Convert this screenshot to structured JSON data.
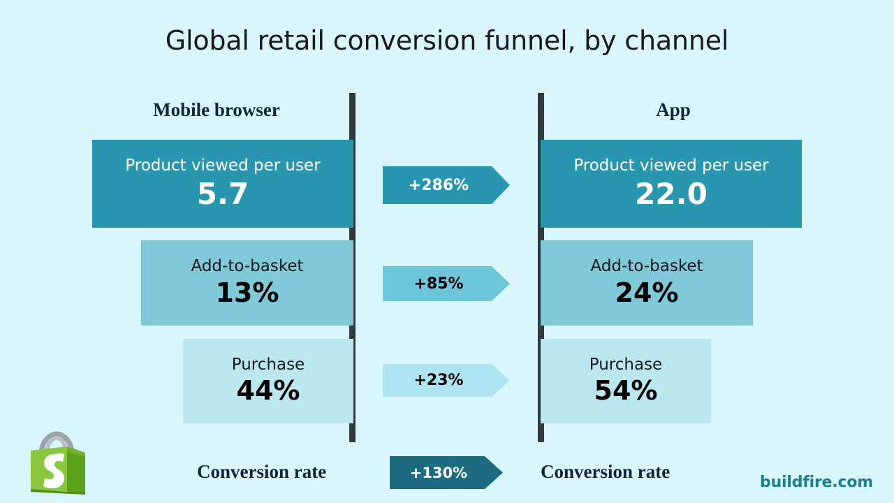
{
  "title": "Global retail conversion funnel, by channel",
  "background_color": "#d9f6fc",
  "columns": {
    "left": {
      "heading": "Mobile browser",
      "conversion_label": "Conversion rate"
    },
    "right": {
      "heading": "App",
      "conversion_label": "Conversion rate"
    }
  },
  "stages": [
    {
      "label": "Product viewed per user",
      "left_value": "5.7",
      "right_value": "22.0",
      "delta": "+286%",
      "bar_color": "#2896af",
      "badge_color": "#2896af"
    },
    {
      "label": "Add-to-basket",
      "left_value": "13%",
      "right_value": "24%",
      "delta": "+85%",
      "bar_color": "#7fc9d9",
      "badge_color": "#6ec6da"
    },
    {
      "label": "Purchase",
      "left_value": "44%",
      "right_value": "54%",
      "delta": "+23%",
      "bar_color": "#bbe7f0",
      "badge_color": "#aee4f2"
    }
  ],
  "conversion_delta": "+130%",
  "conversion_badge_color": "#1c6b80",
  "footer": {
    "brand": "buildfire.com",
    "brand_color": "#1b7f93",
    "logo_name": "shopify-bag-icon"
  },
  "chart_data": {
    "type": "bar",
    "title": "Global retail conversion funnel, by channel",
    "xlabel": "",
    "ylabel": "",
    "categories": [
      "Product viewed per user",
      "Add-to-basket",
      "Purchase"
    ],
    "series": [
      {
        "name": "Mobile browser",
        "values": [
          5.7,
          13,
          44
        ],
        "display": [
          "5.7",
          "13%",
          "44%"
        ]
      },
      {
        "name": "App",
        "values": [
          22.0,
          24,
          54
        ],
        "display": [
          "22.0",
          "24%",
          "54%"
        ]
      }
    ],
    "deltas": [
      "+286%",
      "+85%",
      "+23%"
    ],
    "summary_row": {
      "label": "Conversion rate",
      "delta": "+130%"
    },
    "grid": false,
    "legend": "none"
  }
}
